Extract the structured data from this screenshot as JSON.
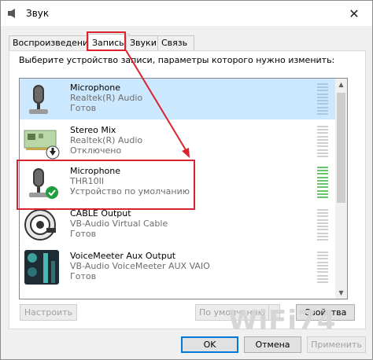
{
  "window": {
    "title": "Звук",
    "close_glyph": "✕",
    "app_icon": "speaker-icon"
  },
  "tabs": [
    {
      "label": "Воспроизведение",
      "active": false
    },
    {
      "label": "Запись",
      "active": true
    },
    {
      "label": "Звуки",
      "active": false
    },
    {
      "label": "Связь",
      "active": false
    }
  ],
  "panel": {
    "hint": "Выберите устройство записи, параметры которого нужно изменить:"
  },
  "devices": [
    {
      "name": "Microphone",
      "driver": "Realtek(R) Audio",
      "state": "Готов",
      "icon": "microphone-icon",
      "selected": true,
      "badge": ""
    },
    {
      "name": "Stereo Mix",
      "driver": "Realtek(R) Audio",
      "state": "Отключено",
      "icon": "sound-card-icon",
      "selected": false,
      "badge": "disabled-arrow"
    },
    {
      "name": "Microphone",
      "driver": "THR10II",
      "state": "Устройство по умолчанию",
      "icon": "microphone-icon",
      "selected": false,
      "badge": "default-check"
    },
    {
      "name": "CABLE Output",
      "driver": "VB-Audio Virtual Cable",
      "state": "Готов",
      "icon": "vb-cable-icon",
      "selected": false,
      "badge": ""
    },
    {
      "name": "VoiceMeeter Aux Output",
      "driver": "VB-Audio VoiceMeeter AUX VAIO",
      "state": "Готов",
      "icon": "voicemeeter-icon",
      "selected": false,
      "badge": ""
    }
  ],
  "buttons": {
    "configure": "Настроить",
    "set_default": "По умолчанию",
    "properties": "Свойства",
    "ok": "OK",
    "cancel": "Отмена",
    "apply": "Применить"
  },
  "annotation_color": "#d9232f",
  "watermark": "WiFi74"
}
